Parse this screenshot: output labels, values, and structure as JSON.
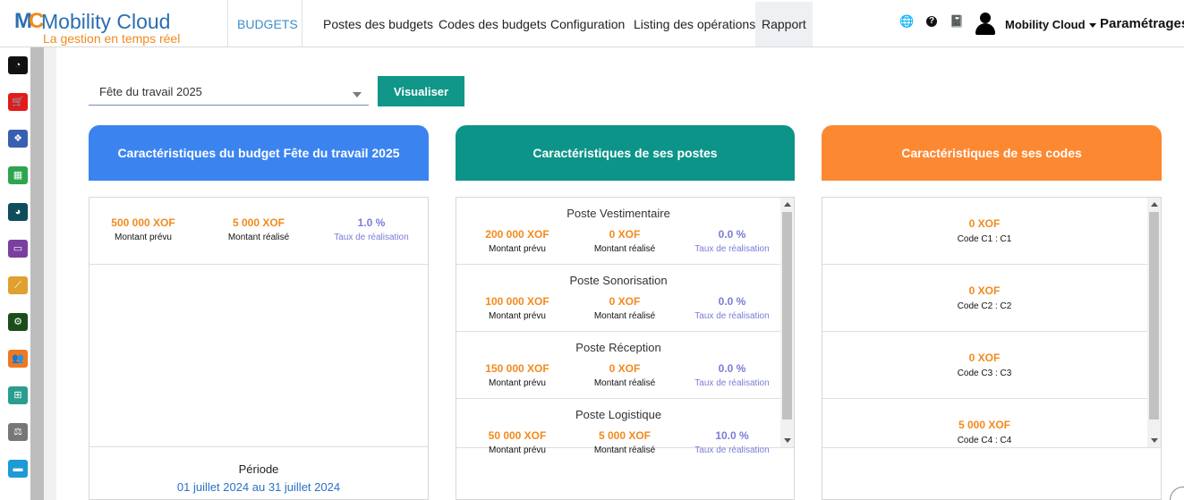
{
  "brand": {
    "mark": "MC",
    "title": "Mobility Cloud",
    "subtitle": "La gestion en temps réel"
  },
  "nav": {
    "module": "BUDGETS",
    "items": [
      {
        "label": "Postes des budgets"
      },
      {
        "label": "Codes des budgets"
      },
      {
        "label": "Configuration"
      },
      {
        "label": "Listing des opérations"
      },
      {
        "label": "Rapport",
        "active": true
      }
    ],
    "user": "Mobility Cloud",
    "settings": "Paramétrages"
  },
  "sidebar": {
    "icons": [
      {
        "name": "dashboard-icon",
        "color": "#111111",
        "glyph": "◔"
      },
      {
        "name": "cart-icon",
        "color": "#e21b1b",
        "glyph": "🛒"
      },
      {
        "name": "cubes-icon",
        "color": "#3a5fb0",
        "glyph": "❖"
      },
      {
        "name": "calculator-icon",
        "color": "#2ea44f",
        "glyph": "▦"
      },
      {
        "name": "pie-chart-icon",
        "color": "#0f4c5c",
        "glyph": "◕"
      },
      {
        "name": "money-icon",
        "color": "#7a3fa0",
        "glyph": "▭"
      },
      {
        "name": "line-chart-icon",
        "color": "#e0a030",
        "glyph": "⟋"
      },
      {
        "name": "cogs-icon",
        "color": "#1a4d1a",
        "glyph": "⚙"
      },
      {
        "name": "users-icon",
        "color": "#f07820",
        "glyph": "👥"
      },
      {
        "name": "sitemap-icon",
        "color": "#2a9d8f",
        "glyph": "⊞"
      },
      {
        "name": "balance-icon",
        "color": "#777777",
        "glyph": "⚖"
      },
      {
        "name": "card-icon",
        "color": "#1e9ad6",
        "glyph": "▬"
      }
    ]
  },
  "filter": {
    "selected_budget": "Fête du travail 2025",
    "button": "Visualiser"
  },
  "budget": {
    "header": "Caractéristiques du budget Fête du travail 2025",
    "montant_prevu": "500 000 XOF",
    "montant_prevu_label": "Montant prévu",
    "montant_realise": "5 000 XOF",
    "montant_realise_label": "Montant réalisé",
    "taux": "1.0 %",
    "taux_label": "Taux de réalisation",
    "period_title": "Période",
    "period_range": "01 juillet 2024 au 31 juillet 2024"
  },
  "postes": {
    "header": "Caractéristiques de ses postes",
    "items": [
      {
        "name": "Poste Vestimentaire",
        "prevu": "200 000 XOF",
        "realise": "0 XOF",
        "taux": "0.0 %"
      },
      {
        "name": "Poste Sonorisation",
        "prevu": "100 000 XOF",
        "realise": "0 XOF",
        "taux": "0.0 %"
      },
      {
        "name": "Poste Réception",
        "prevu": "150 000 XOF",
        "realise": "0 XOF",
        "taux": "0.0 %"
      },
      {
        "name": "Poste Logistique",
        "prevu": "50 000 XOF",
        "realise": "5 000 XOF",
        "taux": "10.0 %"
      }
    ],
    "label_prevu": "Montant prévu",
    "label_realise": "Montant réalisé",
    "label_taux": "Taux de réalisation"
  },
  "codes": {
    "header": "Caractéristiques de ses codes",
    "items": [
      {
        "value": "0 XOF",
        "label": "Code C1 : C1"
      },
      {
        "value": "0 XOF",
        "label": "Code C2 : C2"
      },
      {
        "value": "0 XOF",
        "label": "Code C3 : C3"
      },
      {
        "value": "5 000 XOF",
        "label": "Code C4 : C4"
      }
    ]
  }
}
